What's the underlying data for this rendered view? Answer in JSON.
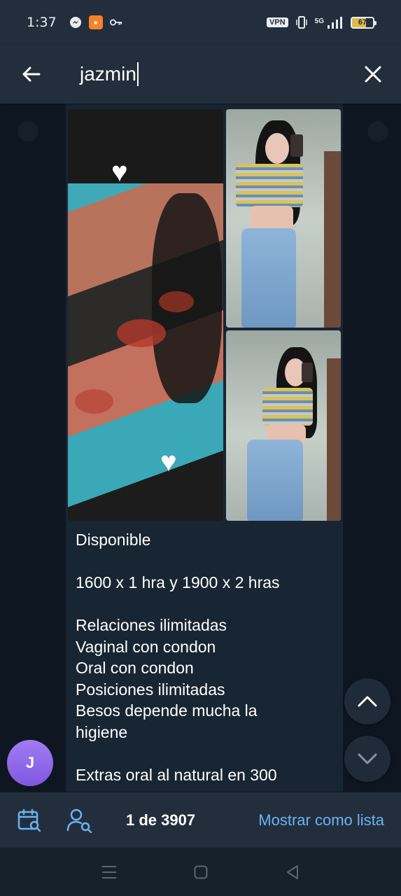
{
  "status_bar": {
    "time": "1:37",
    "left_icons": [
      "messenger-icon",
      "app-notification-icon",
      "key-icon"
    ],
    "vpn_label": "VPN",
    "network_label": "5G",
    "battery_level": "67"
  },
  "search": {
    "query": "jazmin"
  },
  "message": {
    "lines": [
      "Disponible",
      "",
      "1600 x 1 hra y 1900 x 2 hras",
      "",
      "Relaciones ilimitadas",
      "Vaginal con condon",
      "Oral con condon",
      "Posiciones ilimitadas",
      "Besos depende mucha la",
      "higiene",
      "",
      "Extras oral al natural en 300"
    ]
  },
  "avatar": {
    "initial": "J"
  },
  "bottom_bar": {
    "result_count": "1 de 3907",
    "list_button": "Mostrar como lista"
  },
  "colors": {
    "header_bg": "#232e3c",
    "chat_bg": "#0e1621",
    "bubble_bg": "#182533",
    "accent": "#6ab3f3",
    "avatar": "#8e6cf0"
  }
}
